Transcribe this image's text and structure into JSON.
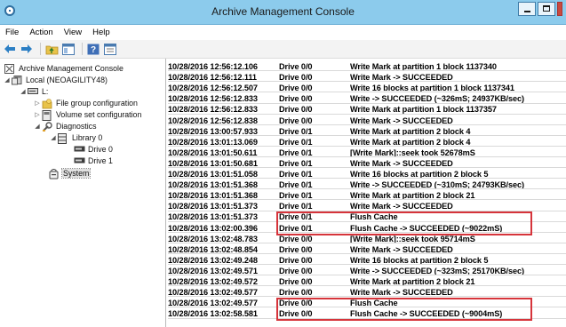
{
  "window": {
    "title": "Archive Management Console"
  },
  "menu": [
    "File",
    "Action",
    "View",
    "Help"
  ],
  "toolbar_icons": [
    "back-arrow-icon",
    "forward-arrow-icon",
    "folder-up-icon",
    "console-tree-icon",
    "help-icon",
    "properties-icon"
  ],
  "tree": {
    "root": "Archive Management Console",
    "local": "Local (NEOAGILITY48)",
    "drive": "L:",
    "file_group": "File group configuration",
    "volume_set": "Volume set configuration",
    "diagnostics": "Diagnostics",
    "library": "Library 0",
    "drive0": "Drive 0",
    "drive1": "Drive 1",
    "system": "System"
  },
  "log": [
    {
      "time": "10/28/2016 12:56:12.106",
      "drive": "Drive 0/0",
      "message": "Write Mark at partition 1 block 1137340"
    },
    {
      "time": "10/28/2016 12:56:12.111",
      "drive": "Drive 0/0",
      "message": "Write Mark -> SUCCEEDED"
    },
    {
      "time": "10/28/2016 12:56:12.507",
      "drive": "Drive 0/0",
      "message": "Write 16 blocks at partition 1 block 1137341"
    },
    {
      "time": "10/28/2016 12:56:12.833",
      "drive": "Drive 0/0",
      "message": "Write -> SUCCEEDED (~326mS; 24937KB/sec)"
    },
    {
      "time": "10/28/2016 12:56:12.833",
      "drive": "Drive 0/0",
      "message": "Write Mark at partition 1 block 1137357"
    },
    {
      "time": "10/28/2016 12:56:12.838",
      "drive": "Drive 0/0",
      "message": "Write Mark -> SUCCEEDED"
    },
    {
      "time": "10/28/2016 13:00:57.933",
      "drive": "Drive 0/1",
      "message": "Write Mark at partition 2 block 4"
    },
    {
      "time": "10/28/2016 13:01:13.069",
      "drive": "Drive 0/1",
      "message": "Write Mark at partition 2 block 4"
    },
    {
      "time": "10/28/2016 13:01:50.611",
      "drive": "Drive 0/1",
      "message": "[Write Mark]::seek took 52678mS"
    },
    {
      "time": "10/28/2016 13:01:50.681",
      "drive": "Drive 0/1",
      "message": "Write Mark -> SUCCEEDED"
    },
    {
      "time": "10/28/2016 13:01:51.058",
      "drive": "Drive 0/1",
      "message": "Write 16 blocks at partition 2 block 5"
    },
    {
      "time": "10/28/2016 13:01:51.368",
      "drive": "Drive 0/1",
      "message": "Write -> SUCCEEDED (~310mS; 24793KB/sec)"
    },
    {
      "time": "10/28/2016 13:01:51.368",
      "drive": "Drive 0/1",
      "message": "Write Mark at partition 2 block 21"
    },
    {
      "time": "10/28/2016 13:01:51.373",
      "drive": "Drive 0/1",
      "message": "Write Mark -> SUCCEEDED"
    },
    {
      "time": "10/28/2016 13:01:51.373",
      "drive": "Drive 0/1",
      "message": "Flush Cache"
    },
    {
      "time": "10/28/2016 13:02:00.396",
      "drive": "Drive 0/1",
      "message": "Flush Cache -> SUCCEEDED (~9022mS)"
    },
    {
      "time": "10/28/2016 13:02:48.783",
      "drive": "Drive 0/0",
      "message": "[Write Mark]::seek took 95714mS"
    },
    {
      "time": "10/28/2016 13:02:48.854",
      "drive": "Drive 0/0",
      "message": "Write Mark -> SUCCEEDED"
    },
    {
      "time": "10/28/2016 13:02:49.248",
      "drive": "Drive 0/0",
      "message": "Write 16 blocks at partition 2 block 5"
    },
    {
      "time": "10/28/2016 13:02:49.571",
      "drive": "Drive 0/0",
      "message": "Write -> SUCCEEDED (~323mS; 25170KB/sec)"
    },
    {
      "time": "10/28/2016 13:02:49.572",
      "drive": "Drive 0/0",
      "message": "Write Mark at partition 2 block 21"
    },
    {
      "time": "10/28/2016 13:02:49.577",
      "drive": "Drive 0/0",
      "message": "Write Mark -> SUCCEEDED"
    },
    {
      "time": "10/28/2016 13:02:49.577",
      "drive": "Drive 0/0",
      "message": "Flush Cache"
    },
    {
      "time": "10/28/2016 13:02:58.581",
      "drive": "Drive 0/0",
      "message": "Flush Cache -> SUCCEEDED (~9004mS)"
    }
  ],
  "colors": {
    "titlebar": "#8ccbec",
    "highlight_box": "#d6343b"
  }
}
